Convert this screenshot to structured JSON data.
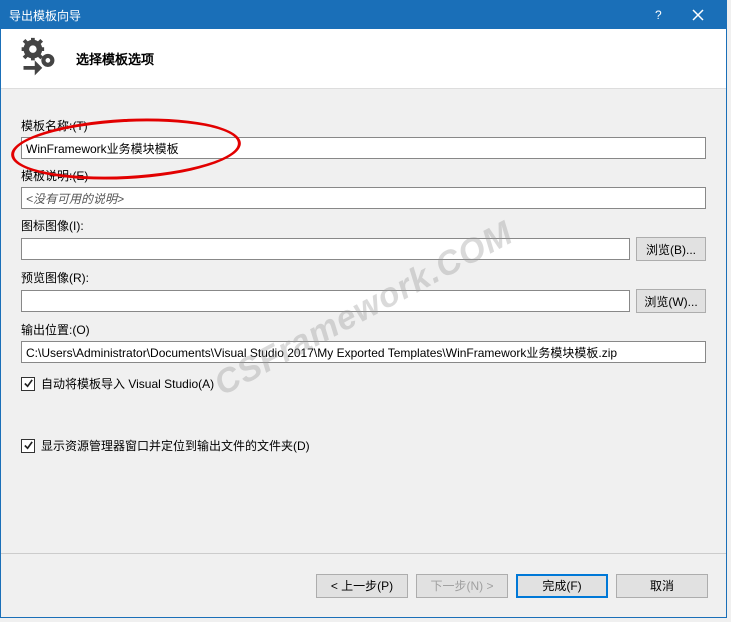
{
  "titlebar": {
    "title": "导出模板向导"
  },
  "header": {
    "title": "选择模板选项"
  },
  "fields": {
    "template_name": {
      "label": "模板名称:(T)",
      "value": "WinFramework业务模块模板"
    },
    "template_desc": {
      "label": "模板说明:(E)",
      "value": "<没有可用的说明>"
    },
    "icon_image": {
      "label": "图标图像(I):",
      "value": "",
      "browse": "浏览(B)..."
    },
    "preview_image": {
      "label": "预览图像(R):",
      "value": "",
      "browse": "浏览(W)..."
    },
    "output_loc": {
      "label": "输出位置:(O)",
      "value": "C:\\Users\\Administrator\\Documents\\Visual Studio 2017\\My Exported Templates\\WinFramework业务模块模板.zip"
    }
  },
  "checkboxes": {
    "auto_import": {
      "label": "自动将模板导入 Visual Studio(A)",
      "checked": true
    },
    "show_explorer": {
      "label": "显示资源管理器窗口并定位到输出文件的文件夹(D)",
      "checked": true
    }
  },
  "footer": {
    "prev": "< 上一步(P)",
    "next": "下一步(N) >",
    "finish": "完成(F)",
    "cancel": "取消"
  },
  "watermark": "CSFramework.COM"
}
